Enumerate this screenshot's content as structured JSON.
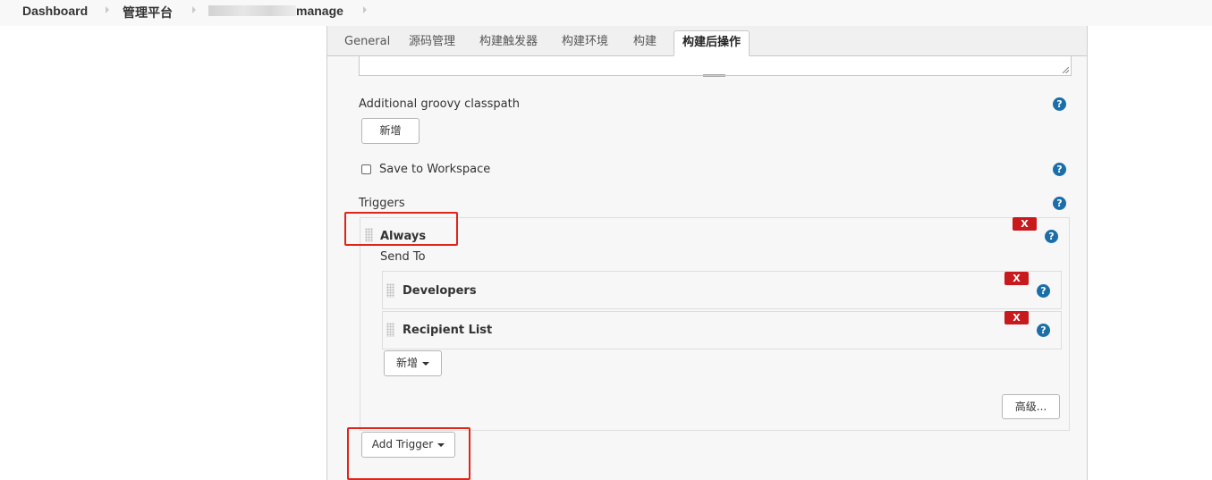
{
  "breadcrumb": {
    "items": [
      "Dashboard",
      "管理平台",
      "manage"
    ]
  },
  "tabs": [
    "General",
    "源码管理",
    "构建触发器",
    "构建环境",
    "构建",
    "构建后操作"
  ],
  "active_tab": "构建后操作",
  "groovy": {
    "label": "Additional groovy classpath",
    "add_label": "新增"
  },
  "save_workspace": {
    "label": "Save to Workspace",
    "checked": false
  },
  "triggers": {
    "label": "Triggers",
    "always": {
      "title": "Always",
      "remove_label": "X",
      "send_to_label": "Send To",
      "recipients": [
        {
          "title": "Developers",
          "remove_label": "X"
        },
        {
          "title": "Recipient List",
          "remove_label": "X"
        }
      ],
      "add_label": "新增",
      "advanced_label": "高级..."
    },
    "add_trigger_label": "Add Trigger"
  },
  "help_glyph": "?",
  "colors": {
    "help": "#1b6ea8",
    "remove": "#c8191c",
    "highlight": "#e0241a"
  }
}
